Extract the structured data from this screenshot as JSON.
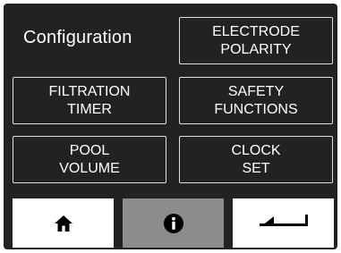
{
  "screen": {
    "title": "Configuration"
  },
  "menu": [
    {
      "id": "electrode-polarity",
      "line1": "ELECTRODE",
      "line2": "POLARITY"
    },
    {
      "id": "filtration-timer",
      "line1": "FILTRATION",
      "line2": "TIMER"
    },
    {
      "id": "safety-functions",
      "line1": "SAFETY",
      "line2": "FUNCTIONS"
    },
    {
      "id": "pool-volume",
      "line1": "POOL",
      "line2": "VOLUME"
    },
    {
      "id": "clock-set",
      "line1": "CLOCK",
      "line2": "SET"
    }
  ],
  "bottom_bar": {
    "home_icon": "home-icon",
    "info_icon": "info-icon",
    "back_icon": "return-arrow-icon"
  },
  "colors": {
    "screen_background": "#222222",
    "text": "#ffffff",
    "bottom_button_light": "#ffffff",
    "bottom_button_active": "#8c8c8c",
    "icon": "#000000"
  }
}
